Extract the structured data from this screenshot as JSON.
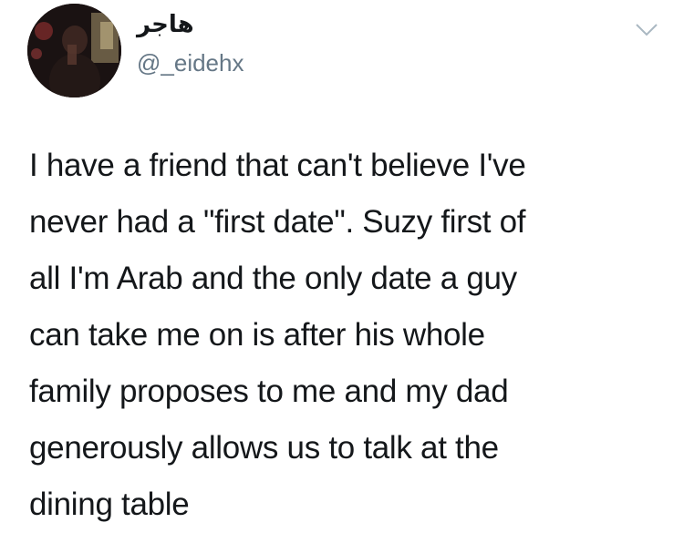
{
  "header": {
    "display_name": "هاجر",
    "username": "@_eidehx"
  },
  "icons": {
    "avatar": "profile-photo",
    "menu": "chevron-down-icon"
  },
  "tweet": {
    "lines": [
      "I have a friend that can't believe I've",
      "never had a \"first date\". Suzy first of",
      "all I'm Arab and the only date a guy",
      "can take me on is after his whole",
      "family proposes to me and my dad",
      "generously allows us to talk at the",
      "dining table"
    ]
  },
  "colors": {
    "text": "#14171a",
    "secondary": "#657786",
    "chevron": "#aab8c2"
  }
}
